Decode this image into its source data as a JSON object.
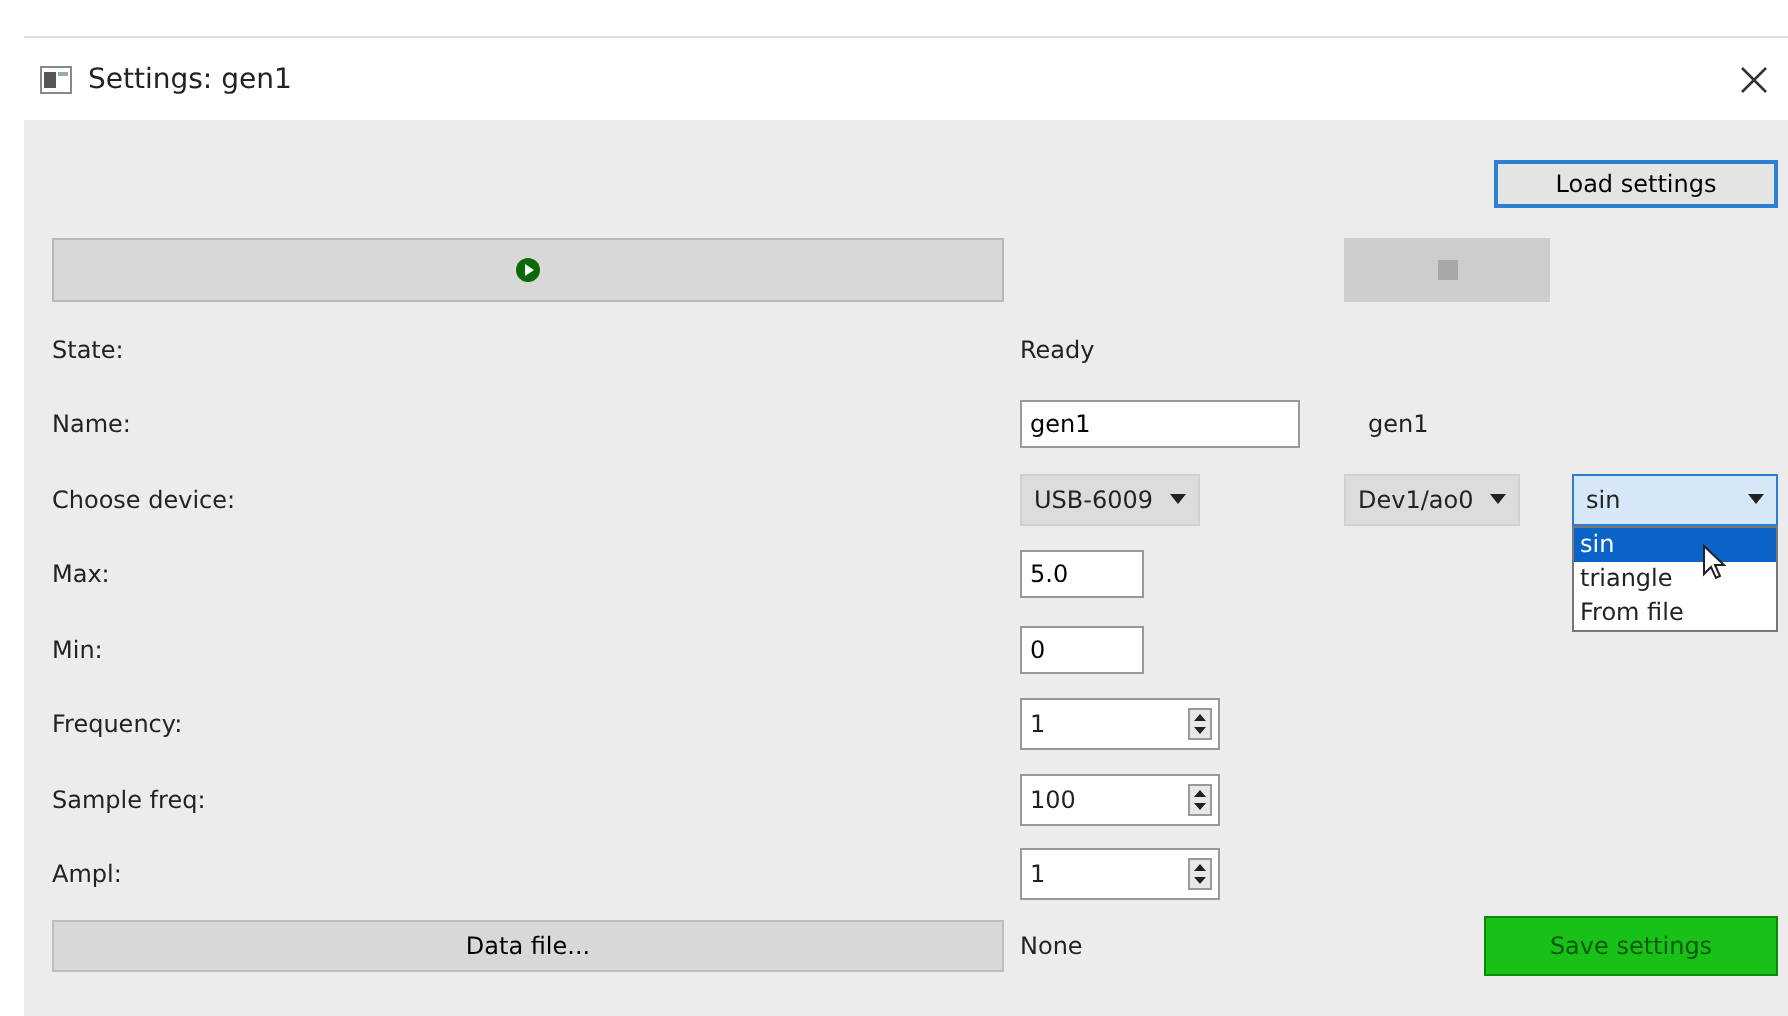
{
  "window": {
    "title": "Settings: gen1"
  },
  "load_button": "Load settings",
  "fields": [
    {
      "kind": "text",
      "label": "State:",
      "value": "Ready"
    },
    {
      "kind": "input",
      "label": "Name:",
      "value": "gen1",
      "echo": "gen1"
    },
    {
      "kind": "combos",
      "label": "Choose device:",
      "combos": [
        {
          "value": "USB-6009",
          "open": false
        },
        {
          "value": "Dev1/ao0",
          "open": false
        },
        {
          "value": "sin",
          "open": true,
          "options": [
            {
              "label": "sin",
              "selected": true
            },
            {
              "label": "triangle",
              "selected": false
            },
            {
              "label": "From file",
              "selected": false
            }
          ]
        }
      ]
    },
    {
      "kind": "input",
      "label": "Max:",
      "value": "5.0"
    },
    {
      "kind": "input",
      "label": "Min:",
      "value": "0"
    },
    {
      "kind": "spin",
      "label": "Frequency:",
      "value": "1"
    },
    {
      "kind": "spin",
      "label": "Sample freq:",
      "value": "100"
    },
    {
      "kind": "spin",
      "label": "Ampl:",
      "value": "1"
    }
  ],
  "data_file_button": "Data file...",
  "data_file_value": "None",
  "save_button": "Save settings"
}
